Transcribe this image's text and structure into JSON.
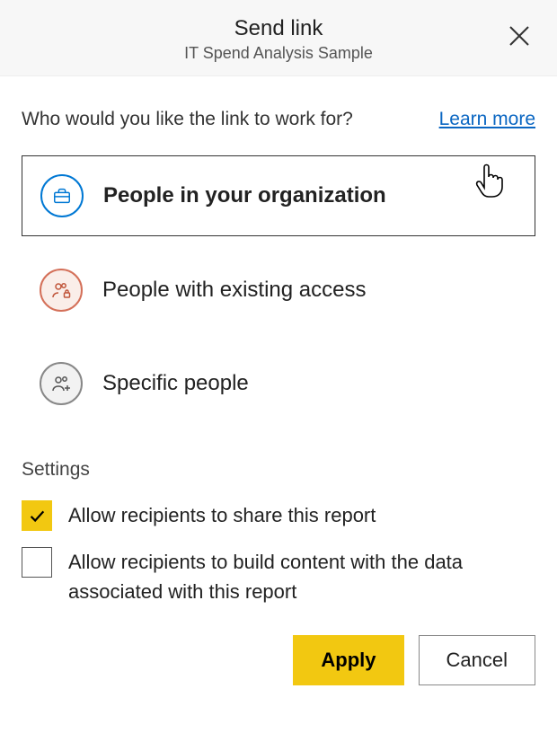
{
  "header": {
    "title": "Send link",
    "subtitle": "IT Spend Analysis Sample"
  },
  "prompt": {
    "question": "Who would you like the link to work for?",
    "learn_more": "Learn more"
  },
  "options": {
    "organization": "People in your organization",
    "existing_access": "People with existing access",
    "specific": "Specific people"
  },
  "settings": {
    "heading": "Settings",
    "allow_share": "Allow recipients to share this report",
    "allow_build": "Allow recipients to build content with the data associated with this report"
  },
  "buttons": {
    "apply": "Apply",
    "cancel": "Cancel"
  }
}
